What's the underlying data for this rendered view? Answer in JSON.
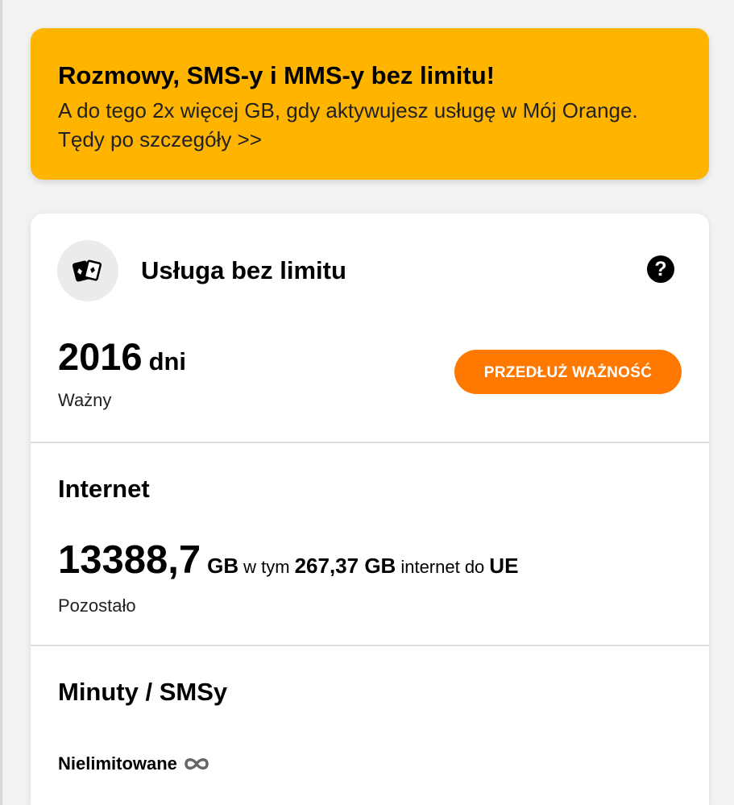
{
  "promo": {
    "title": "Rozmowy, SMS-y i MMS-y bez limitu!",
    "text": "A do tego 2x więcej GB, gdy aktywujesz usługę w Mój Orange. Tędy po szczegóły >>"
  },
  "service": {
    "icon": "cards-icon",
    "title": "Usługa bez limitu",
    "help_icon": "question-circle-icon",
    "help_glyph": "?",
    "days_value": "2016",
    "days_unit": "dni",
    "days_label": "Ważny",
    "extend_button": "PRZEDŁUŻ WAŻNOŚĆ"
  },
  "internet": {
    "title": "Internet",
    "amount": "13388,7",
    "unit": "GB",
    "in_text": "w tym",
    "eu_amount": "267,37 GB",
    "eu_text": "internet do",
    "eu_label": "UE",
    "label": "Pozostało"
  },
  "minutes": {
    "title": "Minuty / SMSy",
    "value": "Nielimitowane",
    "icon": "infinity-icon"
  },
  "colors": {
    "promo_bg": "#ffb400",
    "accent": "#ff7900"
  }
}
